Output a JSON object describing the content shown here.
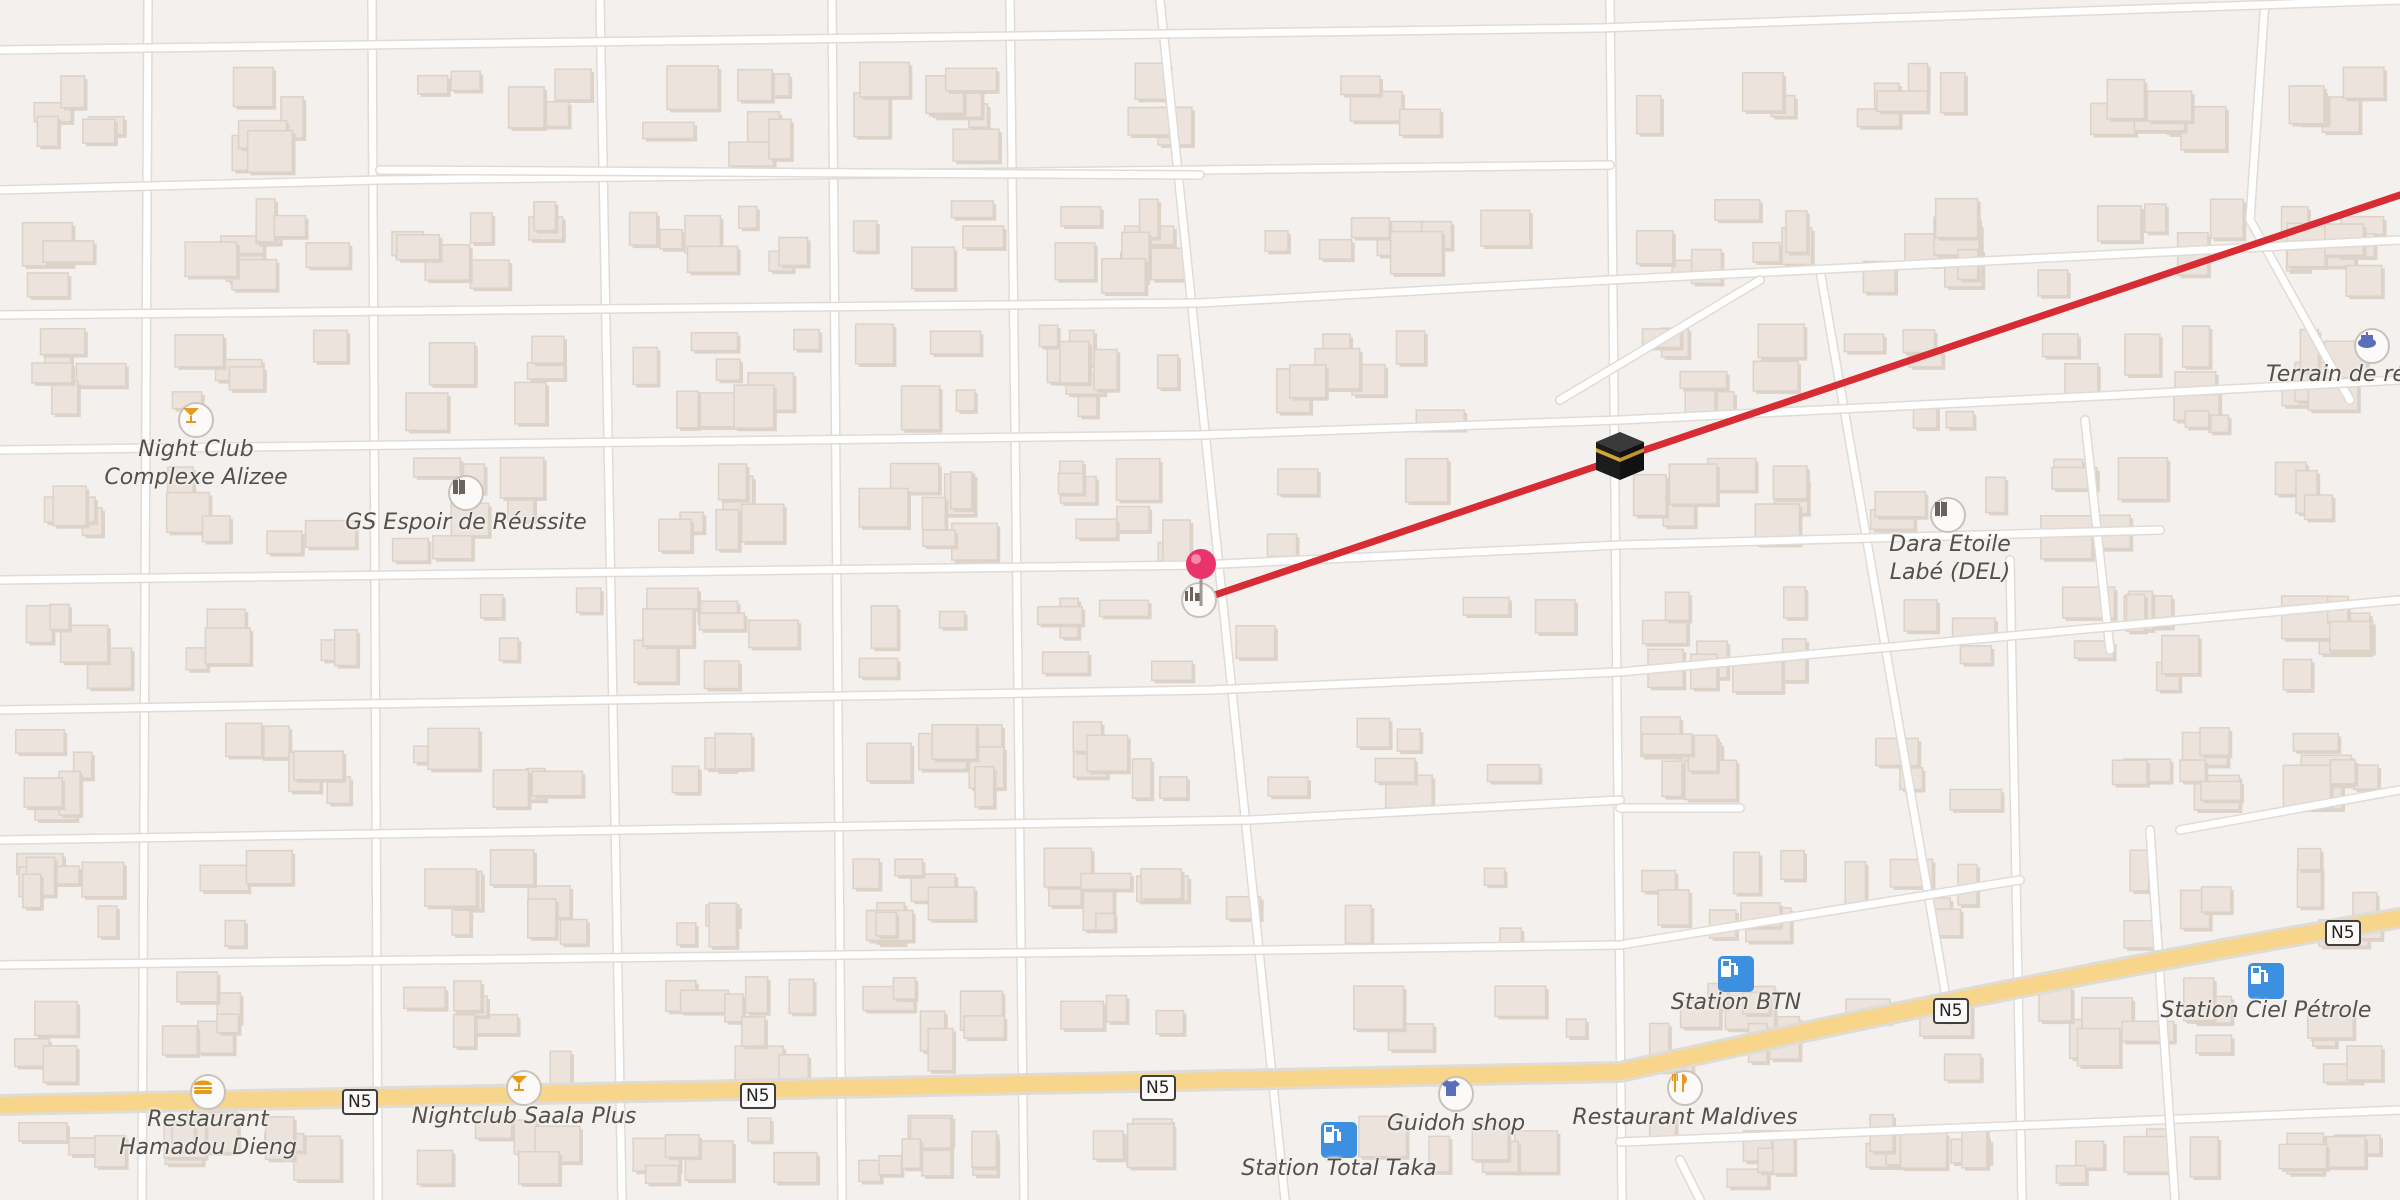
{
  "map": {
    "colors": {
      "background": "#f3f0ed",
      "road": "#ffffff",
      "highway": "#f7d58a",
      "route": "#d72c33",
      "pin": "#e8336b",
      "fuel": "#3d8fe0"
    },
    "route_line": {
      "from": "pin",
      "to": "kaaba-marker-and-beyond"
    },
    "highway_shields": [
      {
        "label": "N5"
      },
      {
        "label": "N5"
      },
      {
        "label": "N5"
      },
      {
        "label": "N5"
      },
      {
        "label": "N5"
      }
    ],
    "pois": {
      "night_club_alizee": {
        "name": "Night Club Complexe Alizee",
        "line1": "Night Club",
        "line2": "Complexe Alizee",
        "icon": "cocktail-icon"
      },
      "gs_espoir": {
        "name": "GS Espoir de Réussite",
        "icon": "school-icon"
      },
      "dara_etoile": {
        "name": "Dara Etoile Labé (DEL)",
        "line1": "Dara Etoile",
        "line2": "Labé (DEL)",
        "icon": "school-icon"
      },
      "terrain": {
        "name": "Terrain de ré",
        "icon": "stadium-icon"
      },
      "station_btn": {
        "name": "Station BTN",
        "icon": "fuel-icon"
      },
      "station_ciel": {
        "name": "Station Ciel Pétrole",
        "icon": "fuel-icon"
      },
      "restaurant_hamadou": {
        "name": "Restaurant Hamadou Dieng",
        "line1": "Restaurant",
        "line2": "Hamadou Dieng",
        "icon": "burger-icon"
      },
      "nightclub_saala": {
        "name": "Nightclub Saala Plus",
        "icon": "cocktail-icon"
      },
      "guidoh_shop": {
        "name": "Guidoh shop",
        "icon": "shirt-icon"
      },
      "restaurant_maldives": {
        "name": "Restaurant Maldives",
        "icon": "restaurant-icon"
      },
      "station_total": {
        "name": "Station Total Taka",
        "icon": "fuel-icon"
      },
      "pin_poi": {
        "name": "",
        "icon": "factory-icon"
      },
      "kaaba": {
        "name": "",
        "icon": "kaaba-icon"
      }
    }
  }
}
